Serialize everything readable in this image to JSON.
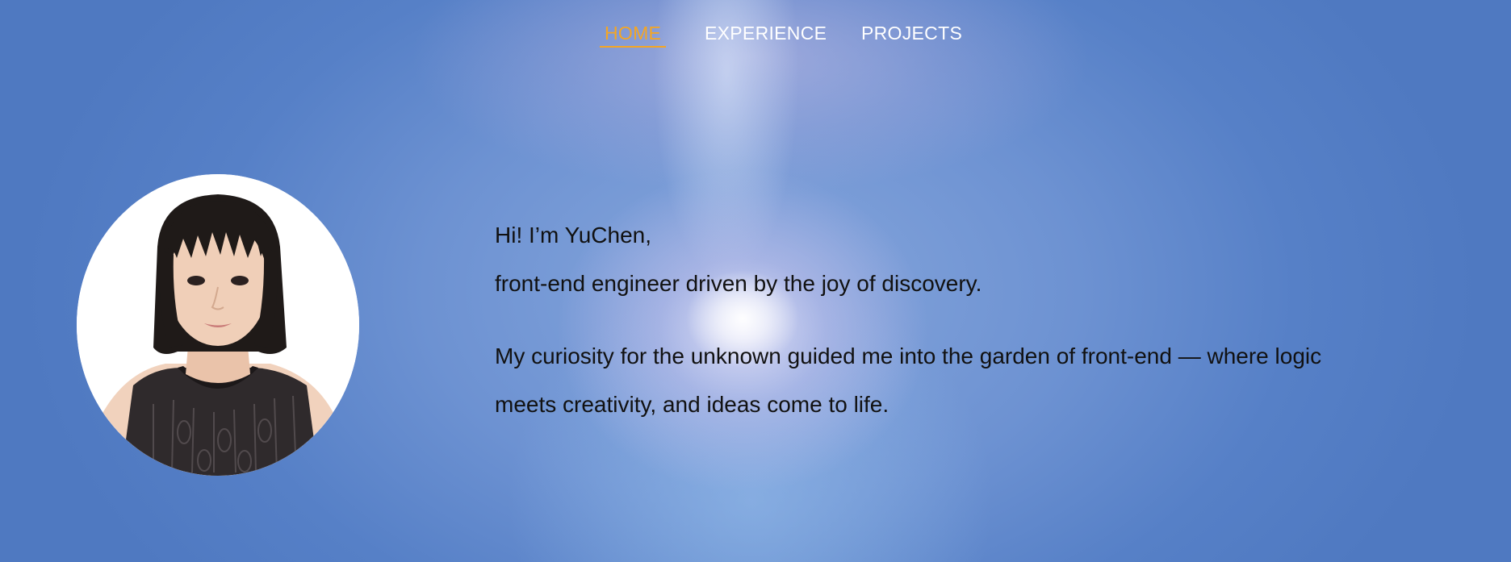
{
  "nav": {
    "items": [
      {
        "label": "HOME",
        "active": true
      },
      {
        "label": "EXPERIENCE",
        "active": false
      },
      {
        "label": "PROJECTS",
        "active": false
      }
    ],
    "active_color": "#f5a623",
    "color": "#ffffff"
  },
  "avatar": {
    "icon": "profile-photo"
  },
  "intro": {
    "greeting": "Hi! I’m YuChen,",
    "tagline": "front-end engineer driven by the joy of discovery.",
    "para_line1": "My curiosity for the unknown guided me into the garden of front-end — where logic",
    "para_line2": "meets creativity, and ideas come to life."
  }
}
